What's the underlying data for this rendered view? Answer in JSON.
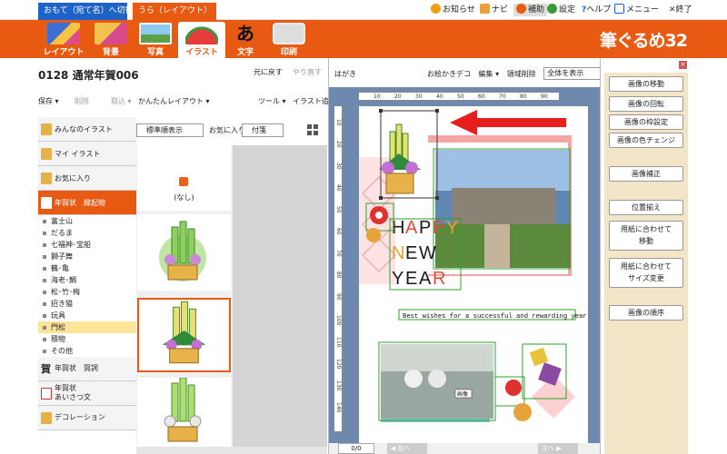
{
  "tabs": {
    "front": "おもて（宛て名）へ切替",
    "back": "うら（レイアウト）"
  },
  "top_menu": {
    "notice": "お知らせ",
    "navi": "ナビ",
    "assist": "補助",
    "settings": "設定",
    "help": "ヘルプ",
    "menu": "メニュー",
    "quit": "終了"
  },
  "toolbar": {
    "layout": "レイアウト",
    "background": "背景",
    "photo": "写真",
    "illust": "イラスト",
    "text": "文字",
    "print": "印刷",
    "text_glyph": "あ"
  },
  "brand": "筆ぐるめ32",
  "left": {
    "doc_title": "0128 通常年賀006",
    "undo": "元に戻す",
    "redo": "やり直す",
    "save": "保存 ▾",
    "delete": "削除",
    "import": "取込 ▾",
    "easy_layout": "かんたんレイアウト ▾",
    "tools": "ツール ▾",
    "add_illust": "イラスト追加",
    "categories": [
      "みんなのイラスト",
      "マイ イラスト",
      "お気に入り"
    ],
    "selected_category": "年賀状　縁起物",
    "subitems": [
      "富士山",
      "だるま",
      "七福神･宝船",
      "獅子舞",
      "鶴･亀",
      "海老･鯛",
      "松･竹･梅",
      "招き猫",
      "玩具",
      "門松",
      "積物",
      "その他"
    ],
    "selected_subitem": "門松",
    "more_categories": [
      {
        "label": "年賀状　賀詞",
        "glyph": "賀"
      },
      {
        "label": "年賀状\nあいさつ文"
      },
      {
        "label": "デコレーション"
      }
    ],
    "sort_select": "標準順表示",
    "fav_label": "お気に入り",
    "fav_select": "付箋",
    "none_label": "(なし)"
  },
  "canvas": {
    "label": "はがき",
    "tools": [
      "お絵かきデコ",
      "編集 ▾",
      "領域削除"
    ],
    "zoom": "全体を表示",
    "ruler_h": [
      "10",
      "20",
      "30",
      "40",
      "50",
      "60",
      "70",
      "80",
      "90"
    ],
    "ruler_v": [
      "10",
      "20",
      "30",
      "40",
      "50",
      "60",
      "70",
      "80",
      "90",
      "100",
      "110",
      "120",
      "130",
      "140"
    ],
    "happy": [
      "H",
      "A",
      "P",
      "P",
      "Y"
    ],
    "new": [
      "N",
      "E",
      "W"
    ],
    "year": [
      "Y",
      "E",
      "A",
      "R"
    ],
    "greeting": "Best wishes for a successful and rewarding year.",
    "photo_label": "画像",
    "page": "0/0",
    "prev": "◀ 前へ",
    "next": "次へ ▶"
  },
  "right": {
    "close": "×",
    "buttons": [
      "画像の移動",
      "画像の回転",
      "画像の枠設定",
      "画像の色チェンジ",
      "画像補正",
      "位置揃え",
      "用紙に合わせて\n移動",
      "用紙に合わせて\nサイズ変更",
      "画像の順序"
    ]
  },
  "colors": {
    "accent_orange": "#e85a12",
    "tab_blue": "#1e64c8",
    "canvas_bg": "#6f88ad",
    "selection_green": "#2ca02c",
    "arrow_red": "#e61e1e"
  }
}
